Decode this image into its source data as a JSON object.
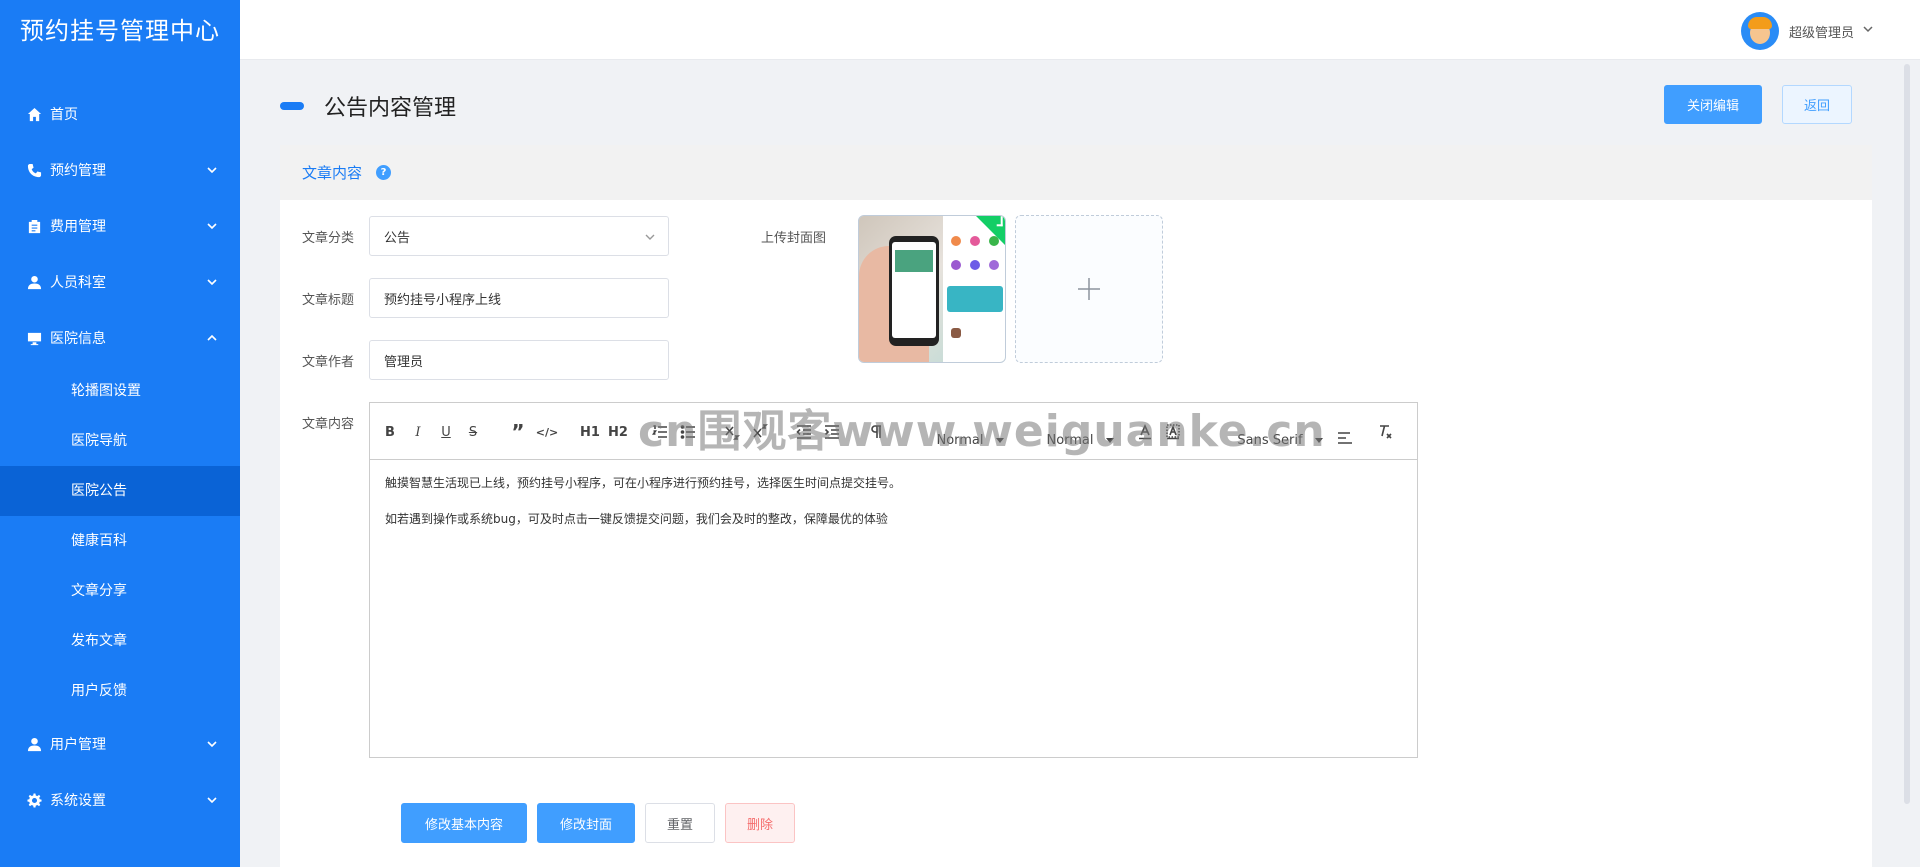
{
  "brand": {
    "title": "预约挂号管理中心"
  },
  "sidebar": {
    "items": [
      {
        "label": "首页",
        "icon": "home-icon",
        "has_children": false
      },
      {
        "label": "预约管理",
        "icon": "phone-icon",
        "has_children": true
      },
      {
        "label": "费用管理",
        "icon": "clipboard-icon",
        "has_children": true
      },
      {
        "label": "人员科室",
        "icon": "user-icon",
        "has_children": true
      },
      {
        "label": "医院信息",
        "icon": "monitor-icon",
        "has_children": true,
        "expanded": true,
        "children": [
          "轮播图设置",
          "医院导航",
          "医院公告",
          "健康百科",
          "文章分享",
          "发布文章",
          "用户反馈"
        ],
        "active_child": "医院公告"
      },
      {
        "label": "用户管理",
        "icon": "user-icon",
        "has_children": true
      },
      {
        "label": "系统设置",
        "icon": "gear-icon",
        "has_children": true
      }
    ]
  },
  "header": {
    "user_name": "超级管理员"
  },
  "page": {
    "title": "公告内容管理",
    "close_edit_label": "关闭编辑",
    "back_label": "返回"
  },
  "card": {
    "title": "文章内容",
    "help": "?"
  },
  "form": {
    "category_label": "文章分类",
    "category_value": "公告",
    "title_label": "文章标题",
    "title_value": "预约挂号小程序上线",
    "author_label": "文章作者",
    "author_value": "管理员",
    "content_label": "文章内容",
    "cover_label": "上传封面图"
  },
  "editor": {
    "toolbar": {
      "bold": "B",
      "italic": "I",
      "underline": "U",
      "strike": "S",
      "quote": "”",
      "code": "</>",
      "h1": "H1",
      "h2": "H2",
      "size": "Normal",
      "header": "Normal",
      "font": "Sans Serif"
    },
    "paragraphs": [
      "触摸智慧生活现已上线，预约挂号小程序，可在小程序进行预约挂号，选择医生时间点提交挂号。",
      "如若遇到操作或系统bug，可及时点击一键反馈提交问题，我们会及时的整改，保障最优的体验"
    ]
  },
  "actions": {
    "edit_basic": "修改基本内容",
    "edit_cover": "修改封面",
    "reset": "重置",
    "delete": "删除"
  },
  "watermark": "cn围观客www.weiguanke.cn",
  "colors": {
    "primary": "#1a7cf5",
    "button_primary": "#409eff",
    "danger": "#f56c6c"
  }
}
